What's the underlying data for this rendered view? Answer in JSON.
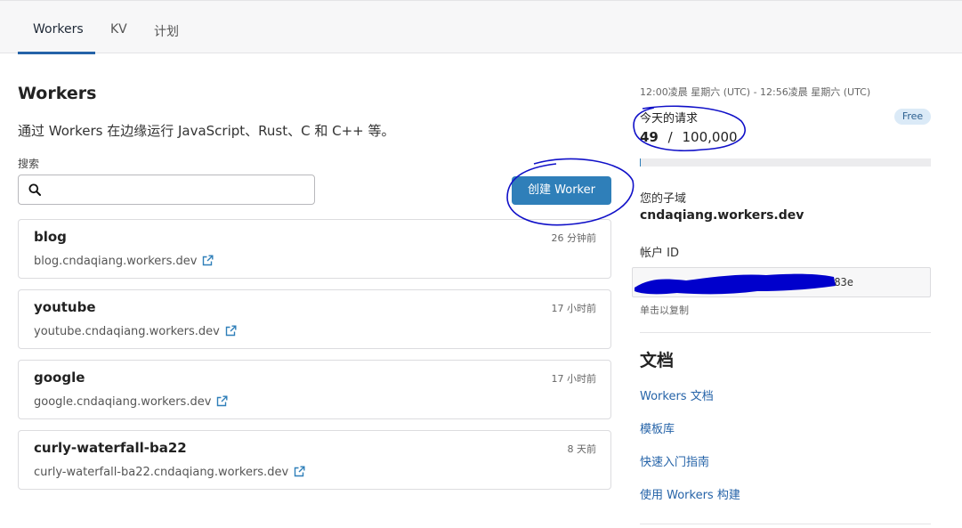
{
  "nav": {
    "tabs": [
      {
        "label": "Workers",
        "active": true
      },
      {
        "label": "KV",
        "active": false
      },
      {
        "label": "计划",
        "active": false
      }
    ]
  },
  "main": {
    "title": "Workers",
    "description": "通过 Workers 在边缘运行 JavaScript、Rust、C 和 C++ 等。",
    "search": {
      "label": "搜索",
      "value": "",
      "placeholder": ""
    },
    "create_button": "创建 Worker",
    "workers": [
      {
        "name": "blog",
        "time": "26 分钟前",
        "url": "blog.cndaqiang.workers.dev"
      },
      {
        "name": "youtube",
        "time": "17 小时前",
        "url": "youtube.cndaqiang.workers.dev"
      },
      {
        "name": "google",
        "time": "17 小时前",
        "url": "google.cndaqiang.workers.dev"
      },
      {
        "name": "curly-waterfall-ba22",
        "time": "8 天前",
        "url": "curly-waterfall-ba22.cndaqiang.workers.dev"
      }
    ]
  },
  "sidebar": {
    "time_range": "12:00凌晨 星期六 (UTC) - 12:56凌晨 星期六 (UTC)",
    "requests_label": "今天的请求",
    "requests_used": "49",
    "requests_sep": "/",
    "requests_limit": "100,000",
    "requests_fraction": 0.00049,
    "plan_badge": "Free",
    "subdomain_label": "您的子域",
    "subdomain_value": "cndaqiang.workers.dev",
    "account_label": "帐户 ID",
    "account_id_visible": "83e",
    "copy_hint": "单击以复制",
    "docs_title": "文档",
    "doc_links": [
      "Workers 文档",
      "模板库",
      "快速入门指南",
      "使用 Workers 构建"
    ]
  },
  "colors": {
    "accent": "#2f7fb9",
    "link": "#2563a8",
    "annotation_ink": "#1010c8",
    "redaction": "#0000cc"
  },
  "icons": {
    "search": "search-icon",
    "external": "external-link-icon"
  }
}
